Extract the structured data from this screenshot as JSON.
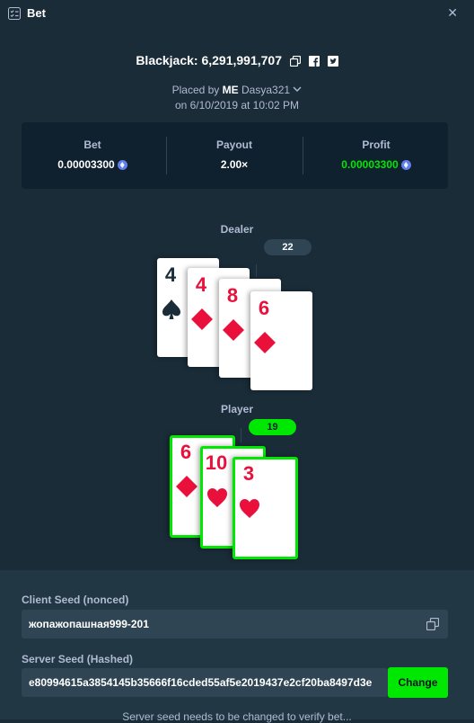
{
  "header": {
    "title": "Bet",
    "title_icon": "list-check-icon",
    "close_icon": "close-icon",
    "close_glyph": "✕"
  },
  "game": {
    "title": "Blackjack: 6,291,991,707",
    "placed_by_prefix": "Placed by",
    "user_tag": "ME",
    "username": "Dasya321",
    "date_line": "on 6/10/2019 at 10:02 PM"
  },
  "stats": {
    "bet_label": "Bet",
    "bet_value": "0.00003300",
    "payout_label": "Payout",
    "payout_value": "2.00×",
    "profit_label": "Profit",
    "profit_value": "0.00003300"
  },
  "dealer": {
    "label": "Dealer",
    "total": "22",
    "cards": [
      {
        "rank": "4",
        "suit": "spade"
      },
      {
        "rank": "4",
        "suit": "diamond"
      },
      {
        "rank": "8",
        "suit": "diamond"
      },
      {
        "rank": "6",
        "suit": "diamond"
      }
    ]
  },
  "player": {
    "label": "Player",
    "total": "19",
    "cards": [
      {
        "rank": "6",
        "suit": "diamond"
      },
      {
        "rank": "10",
        "suit": "heart"
      },
      {
        "rank": "3",
        "suit": "heart"
      }
    ]
  },
  "seeds": {
    "client_label": "Client Seed (nonced)",
    "client_value": "жопажопашная999-201",
    "server_label": "Server Seed (Hashed)",
    "server_value": "e80994615a3854145b35666f16cded55af5e2019437e2cf20ba8497d3e",
    "change_label": "Change",
    "note": "Server seed needs to be changed to verify bet..."
  },
  "colors": {
    "accent": "#00e701",
    "background": "#1a2c38",
    "panel": "#0f212e",
    "card_red": "#e9113c"
  }
}
